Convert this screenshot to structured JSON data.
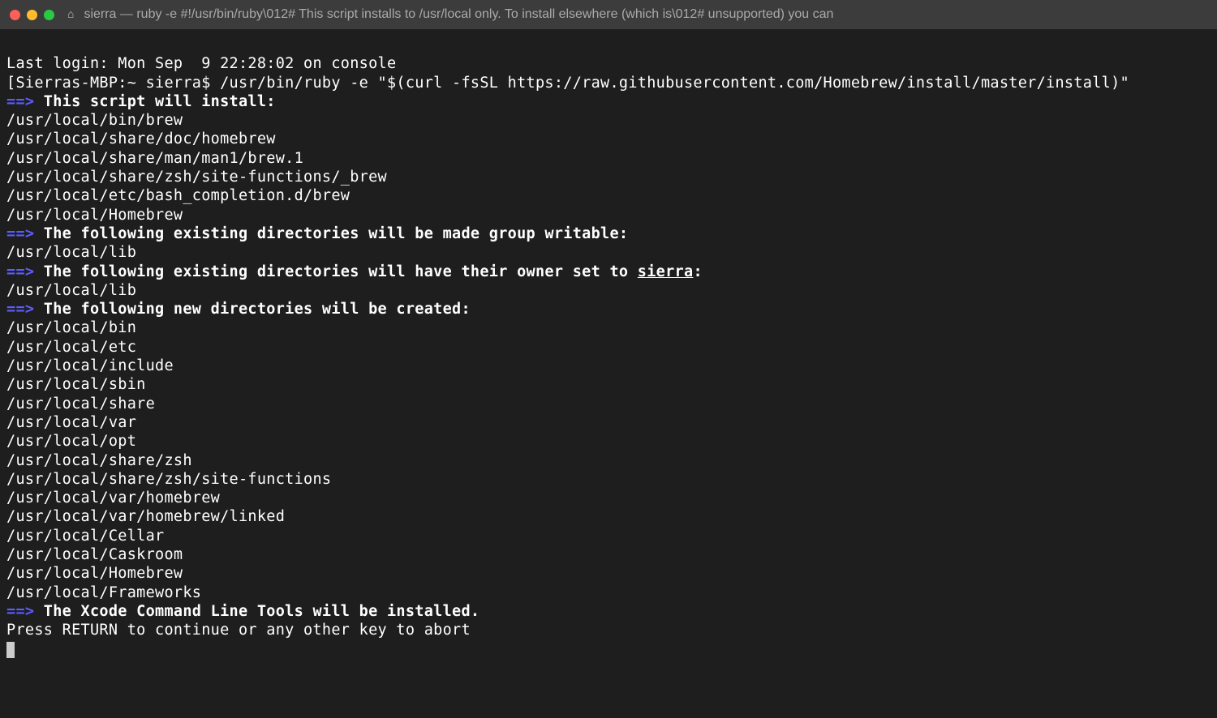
{
  "titlebar": {
    "title": "sierra — ruby -e #!/usr/bin/ruby\\012# This script installs to /usr/local only. To install elsewhere (which is\\012# unsupported) you can"
  },
  "terminal": {
    "last_login": "Last login: Mon Sep  9 22:28:02 on console",
    "prompt_host": "[Sierras-MBP:~ sierra$ ",
    "command": "/usr/bin/ruby -e \"$(curl -fsSL https://raw.githubusercontent.com/Homebrew/install/master/install)\"",
    "arrow": "==>",
    "heading_install": " This script will install:",
    "install_paths": [
      "/usr/local/bin/brew",
      "/usr/local/share/doc/homebrew",
      "/usr/local/share/man/man1/brew.1",
      "/usr/local/share/zsh/site-functions/_brew",
      "/usr/local/etc/bash_completion.d/brew",
      "/usr/local/Homebrew"
    ],
    "heading_writable": " The following existing directories will be made group writable:",
    "writable_paths": [
      "/usr/local/lib"
    ],
    "heading_owner_pre": " The following existing directories will have their owner set to ",
    "owner_user": "sierra",
    "heading_owner_post": ":",
    "owner_paths": [
      "/usr/local/lib"
    ],
    "heading_newdir": " The following new directories will be created:",
    "newdir_paths": [
      "/usr/local/bin",
      "/usr/local/etc",
      "/usr/local/include",
      "/usr/local/sbin",
      "/usr/local/share",
      "/usr/local/var",
      "/usr/local/opt",
      "/usr/local/share/zsh",
      "/usr/local/share/zsh/site-functions",
      "/usr/local/var/homebrew",
      "/usr/local/var/homebrew/linked",
      "/usr/local/Cellar",
      "/usr/local/Caskroom",
      "/usr/local/Homebrew",
      "/usr/local/Frameworks"
    ],
    "heading_xcode": " The Xcode Command Line Tools will be installed.",
    "blank": "",
    "prompt_continue": "Press RETURN to continue or any other key to abort"
  }
}
